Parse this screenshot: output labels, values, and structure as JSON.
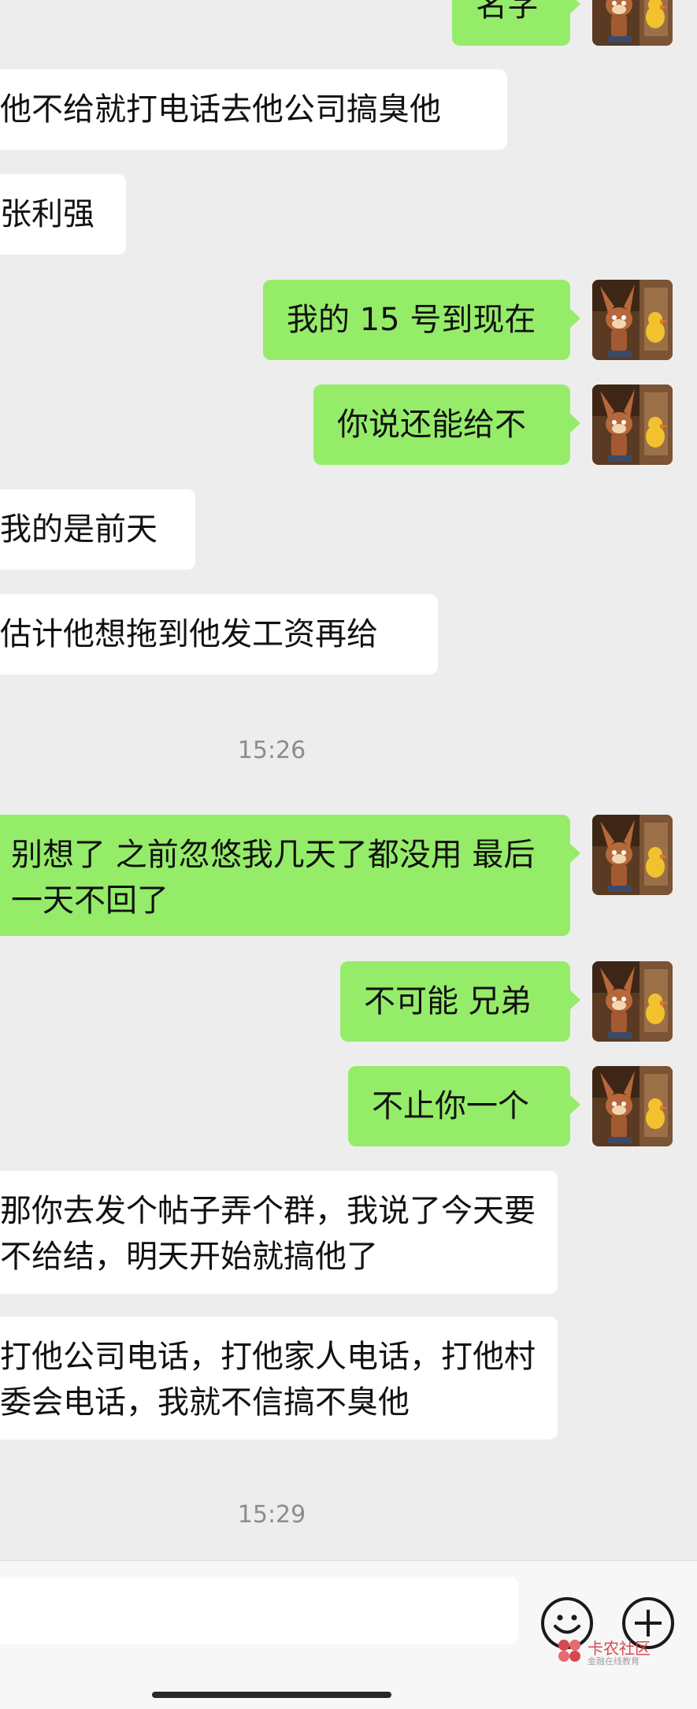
{
  "chat": {
    "messages": [
      {
        "side": "right",
        "text": "名字"
      },
      {
        "side": "left",
        "text": "他不给就打电话去他公司搞臭他"
      },
      {
        "side": "left",
        "text": "张利强"
      },
      {
        "side": "right",
        "text": "我的 15 号到现在"
      },
      {
        "side": "right",
        "text": "你说还能给不"
      },
      {
        "side": "left",
        "text": "我的是前天"
      },
      {
        "side": "left",
        "text": "估计他想拖到他发工资再给"
      },
      {
        "side": "right",
        "text": "别想了 之前忽悠我几天了都没用 最后一天不回了"
      },
      {
        "side": "right",
        "text": "不可能 兄弟"
      },
      {
        "side": "right",
        "text": "不止你一个"
      },
      {
        "side": "left",
        "text": "那你去发个帖子弄个群，我说了今天要不给结，明天开始就搞他了"
      },
      {
        "side": "left",
        "text": "打他公司电话，打他家人电话，打他村委会电话，我就不信搞不臭他"
      }
    ],
    "timestamps": [
      "15:26",
      "15:29"
    ]
  },
  "input_bar": {
    "emoji_icon": "emoji-icon",
    "plus_icon": "plus-icon"
  },
  "watermark": {
    "title": "卡农社区",
    "subtitle": "金融在线教育"
  },
  "colors": {
    "background": "#ededed",
    "outgoing_bubble": "#95ec69",
    "incoming_bubble": "#ffffff",
    "timestamp": "#8c8c8c"
  }
}
